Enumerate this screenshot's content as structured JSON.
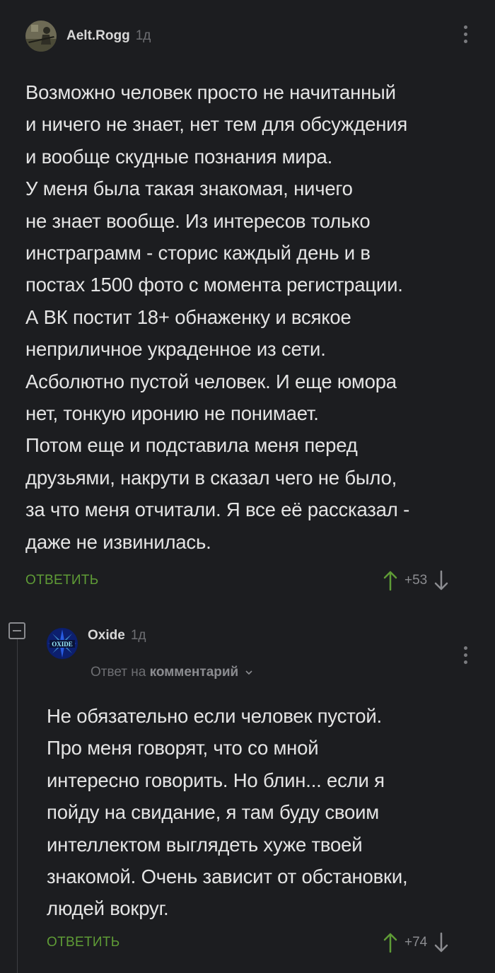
{
  "comments": [
    {
      "author": "Aelt.Rogg",
      "time": "1д",
      "avatar_icon": "user-avatar-photo",
      "text": "Возможно человек просто не начитанный\nи ничего не знает, нет тем для обсуждения\nи вообще скудные познания мира.\nУ меня была такая знакомая, ничего\nне знает вообще. Из интересов только\nинстраграмм - сторис каждый день и в\nпостах 1500 фото с момента регистрации.\nА ВК постит 18+ обнаженку и всякое\nнеприличное украденное из сети.\nАсболютно пустой человек. И еще юмора\nнет, тонкую иронию не понимает.\nПотом еще и подставила меня перед\nдрузьями, накрути в сказал чего не было,\nза что меня отчитали. Я все её рассказал -\nдаже не извинилась.",
      "reply_label": "ОТВЕТИТЬ",
      "score": "+53"
    },
    {
      "author": "Oxide",
      "time": "1д",
      "avatar_text": "OXIDE",
      "reply_prefix": "Ответ на",
      "reply_target": "комментарий",
      "text": "Не обязательно если человек пустой.\nПро меня говорят, что со мной\nинтересно говорить. Но блин... если я\nпойду на свидание, я там буду своим\nинтеллектом выглядеть хуже твоей\nзнакомой. Очень зависит от обстановки,\nлюдей вокруг.",
      "reply_label": "ОТВЕТИТЬ",
      "score": "+74"
    }
  ],
  "colors": {
    "background": "#1c1d20",
    "accent_green": "#5f9c36",
    "text": "#e4e4e4",
    "muted": "#6e6f73"
  }
}
